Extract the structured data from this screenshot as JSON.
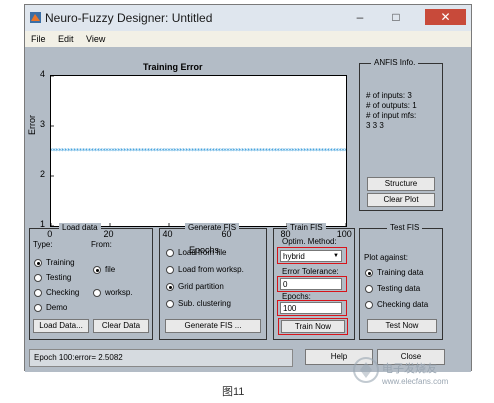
{
  "window": {
    "title": "Neuro-Fuzzy Designer: Untitled"
  },
  "menu": [
    "File",
    "Edit",
    "View"
  ],
  "axes": {
    "title": "Training Error",
    "xlabel": "Epochs",
    "ylabel": "Error",
    "xticks": [
      "0",
      "20",
      "40",
      "60",
      "80",
      "100"
    ],
    "yticks": [
      "1",
      "2",
      "3",
      "4"
    ]
  },
  "chart_data": {
    "type": "scatter",
    "title": "Training Error",
    "xlabel": "Epochs",
    "ylabel": "Error",
    "xlim": [
      0,
      100
    ],
    "ylim": [
      1,
      4
    ],
    "x_start": 0,
    "x_end": 100,
    "y": 2.5082
  },
  "anfis_info": {
    "title": "ANFIS Info.",
    "lines": [
      "# of inputs: 3",
      "# of outputs: 1",
      "# of input mfs:",
      "3 3 3"
    ],
    "structure_label": "Structure",
    "clear_plot_label": "Clear Plot"
  },
  "load_data": {
    "title": "Load data",
    "type_label": "Type:",
    "from_label": "From:",
    "types": [
      "Training",
      "Testing",
      "Checking",
      "Demo"
    ],
    "selected_type": "Training",
    "sources": [
      "file",
      "worksp."
    ],
    "selected_source": "file",
    "load_button": "Load Data...",
    "clear_button": "Clear Data"
  },
  "generate_fis": {
    "title": "Generate FIS",
    "options": [
      "Load from file",
      "Load from worksp.",
      "Grid partition",
      "Sub. clustering"
    ],
    "selected": "Grid partition",
    "button": "Generate FIS ..."
  },
  "train_fis": {
    "title": "Train FIS",
    "optim_label": "Optim. Method:",
    "optim_value": "hybrid",
    "tolerance_label": "Error Tolerance:",
    "tolerance_value": "0",
    "epochs_label": "Epochs:",
    "epochs_value": "100",
    "button": "Train Now"
  },
  "test_fis": {
    "title": "Test FIS",
    "plot_label": "Plot against:",
    "options": [
      "Training data",
      "Testing data",
      "Checking data"
    ],
    "selected": "Training data",
    "button": "Test Now"
  },
  "status": "Epoch 100:error= 2.5082",
  "help_label": "Help",
  "close_label": "Close",
  "caption": "图11",
  "watermark": {
    "line1": "电子发烧友",
    "line2": "www.elecfans.com"
  }
}
